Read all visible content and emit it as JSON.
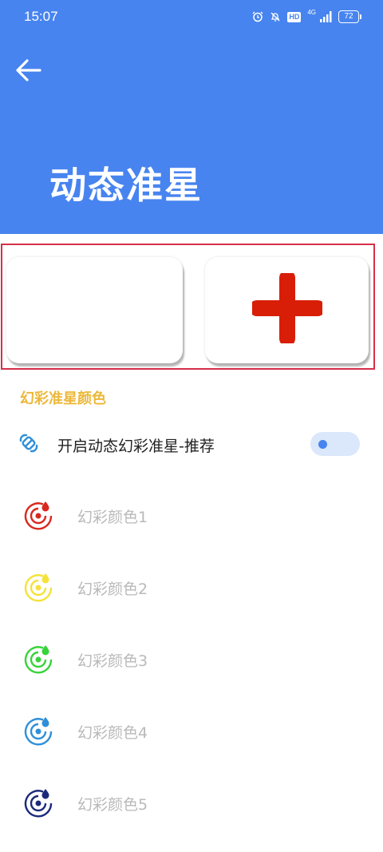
{
  "status": {
    "time": "15:07",
    "hd": "HD",
    "network": "4G",
    "battery": "72"
  },
  "header": {
    "title": "动态准星",
    "background_color": "#4784ef",
    "back_icon": "arrow-left-icon"
  },
  "preview": {
    "left_card_content": "",
    "right_card_crosshair_icon": "plus-crosshair-icon",
    "crosshair_color": "#d81e06",
    "highlight_border_color": "#d4304a"
  },
  "section": {
    "label": "幻彩准星颜色",
    "label_color": "#ecb83a"
  },
  "toggle": {
    "label": "开启动态幻彩准星-推荐",
    "icon": "link-icon",
    "state": "off"
  },
  "colors": [
    {
      "label": "幻彩颜色1",
      "color": "#d9281e"
    },
    {
      "label": "幻彩颜色2",
      "color": "#f4e23a"
    },
    {
      "label": "幻彩颜色3",
      "color": "#36d43a"
    },
    {
      "label": "幻彩颜色4",
      "color": "#2f8fd8"
    },
    {
      "label": "幻彩颜色5",
      "color": "#1b2a7a"
    }
  ]
}
